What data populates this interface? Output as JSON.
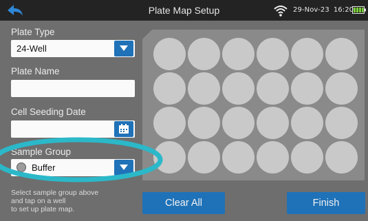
{
  "topbar": {
    "title": "Plate Map Setup",
    "date": "29-Nov-23",
    "time": "16:20",
    "icons": [
      "back-arrow-icon",
      "wifi-icon",
      "battery-icon"
    ]
  },
  "form": {
    "plate_type_label": "Plate Type",
    "plate_type_value": "24-Well",
    "plate_name_label": "Plate Name",
    "plate_name_value": "",
    "seeding_date_label": "Cell Seeding Date",
    "seeding_date_value": "",
    "sample_group_label": "Sample Group",
    "sample_group_value": "Buffer",
    "help_lines": [
      "Select sample group above",
      "and tap on a well",
      "to set up plate map."
    ]
  },
  "plate": {
    "rows": 4,
    "columns": 6
  },
  "buttons": {
    "clear_all": "Clear All",
    "finish": "Finish"
  },
  "colors": {
    "accent": "#1f72b8",
    "highlight_ring": "#2bb8c9",
    "well": "#c9c9c9"
  }
}
